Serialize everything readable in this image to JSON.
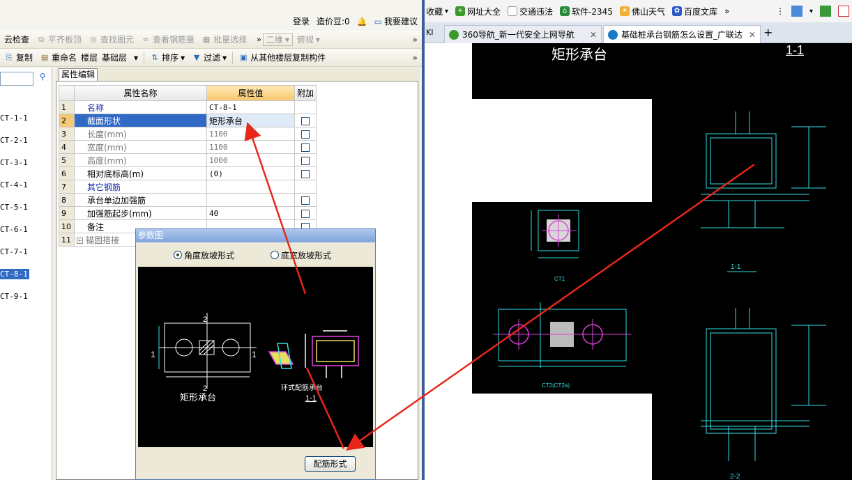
{
  "left_app": {
    "topbar": {
      "login": "登录",
      "beans": "造价豆:0",
      "suggest": "我要建议"
    },
    "toolbar1": {
      "items": [
        "云检查",
        "平齐板顶",
        "查找图元",
        "查看钢筋量",
        "批量选择"
      ],
      "view_2d": "二维",
      "view_top": "俯视"
    },
    "toolbar2": {
      "copy": "复制",
      "rename": "重命名",
      "floor_label": "楼层",
      "floor_value": "基础层",
      "sort": "排序",
      "filter": "过滤",
      "copy_from_floor": "从其他楼层复制构件"
    },
    "tree": {
      "items": [
        "CT-1-1",
        "CT-2-1",
        "CT-3-1",
        "CT-4-1",
        "CT-5-1",
        "CT-6-1",
        "CT-7-1",
        "CT-8-1",
        "CT-9-1"
      ],
      "selected": "CT-8-1"
    },
    "editor": {
      "tab": "属性编辑",
      "headers": {
        "name": "属性名称",
        "value": "属性值",
        "extra": "附加"
      },
      "rows": [
        {
          "num": "1",
          "name": "名称",
          "value": "CT-8-1"
        },
        {
          "num": "2",
          "name": "截面形状",
          "value": "矩形承台"
        },
        {
          "num": "3",
          "name": "长度(mm)",
          "value": "1100"
        },
        {
          "num": "4",
          "name": "宽度(mm)",
          "value": "1100"
        },
        {
          "num": "5",
          "name": "高度(mm)",
          "value": "1000"
        },
        {
          "num": "6",
          "name": "相对底标高(m)",
          "value": "(0)"
        },
        {
          "num": "7",
          "name": "其它钢筋",
          "value": ""
        },
        {
          "num": "8",
          "name": "承台单边加强筋",
          "value": ""
        },
        {
          "num": "9",
          "name": "加强筋起步(mm)",
          "value": "40"
        },
        {
          "num": "10",
          "name": "备注",
          "value": ""
        },
        {
          "num": "11",
          "name": "锚固搭接",
          "value": ""
        }
      ]
    },
    "dialog": {
      "title": "参数图",
      "radio_angle": "角度放坡形式",
      "radio_width": "底宽放坡形式",
      "drawing_caption": "矩形承台",
      "drawing_side_caption": "环式配筋承台",
      "section_label": "1-1",
      "dim_1": "1",
      "dim_2": "2",
      "button": "配筋形式"
    }
  },
  "browser": {
    "favorites": [
      "收藏",
      "网址大全",
      "交通违法",
      "软件-2345",
      "佛山天气",
      "百度文库"
    ],
    "tabs": [
      {
        "label": "360导航_新一代安全上网导航",
        "active": false
      },
      {
        "label": "基础桩承台钢筋怎么设置_广联达",
        "active": true
      }
    ],
    "tab_prefix": "KI",
    "new_tab": "+",
    "page": {
      "header_title": "矩形承台",
      "header_section": "1-1",
      "label_ct1": "CT1",
      "label_11": "1-1",
      "label_ct2": "CT2(CT2a)",
      "label_22": "2-2"
    }
  },
  "colors": {
    "annotation_arrow": "#e8261a",
    "cad_cyan": "#2fe0e6",
    "cad_magenta": "#e040e0"
  }
}
